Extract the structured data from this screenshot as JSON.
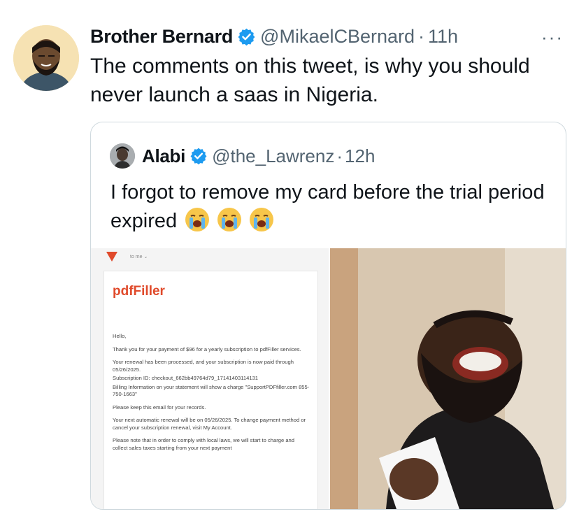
{
  "tweet": {
    "author_name": "Brother Bernard",
    "handle": "@MikaelCBernard",
    "separator": "·",
    "time": "11h",
    "more_label": "···",
    "text": "The comments on this tweet, is why you should never launch a saas in Nigeria."
  },
  "quote": {
    "author_name": "Alabi",
    "handle": "@the_Lawrenz",
    "separator": "·",
    "time": "12h",
    "text": "I forgot to remove my card before the trial period expired",
    "emoji_count": 3
  },
  "email_image": {
    "recipient": "to me ⌄",
    "brand": "pdfFiller",
    "lines": [
      "Hello,",
      "Thank you for your payment of $96 for a yearly subscription to pdfFiller services.",
      "Your renewal has been processed, and your subscription is now paid through 05/26/2025.",
      "Subscription ID: checkout_662bb49764d79_17141403114131",
      "Billing Information on your statement will show a charge \"SupportPDFfiller.com 855-750-1663\"",
      "Please keep this email for your records.",
      "Your next automatic renewal will be on 05/26/2025. To change payment method or cancel your subscription renewal, visit My Account.",
      "Please note that in order to comply with local laws, we will start to charge and collect sales taxes starting from your next payment"
    ]
  },
  "colors": {
    "verified": "#1d9bf0",
    "secondary_text": "#536471",
    "brand_orange": "#e04a2b",
    "border": "#cfd9de"
  },
  "icons": [
    "verified-badge-icon",
    "more-icon",
    "loudly-crying-face-emoji"
  ]
}
